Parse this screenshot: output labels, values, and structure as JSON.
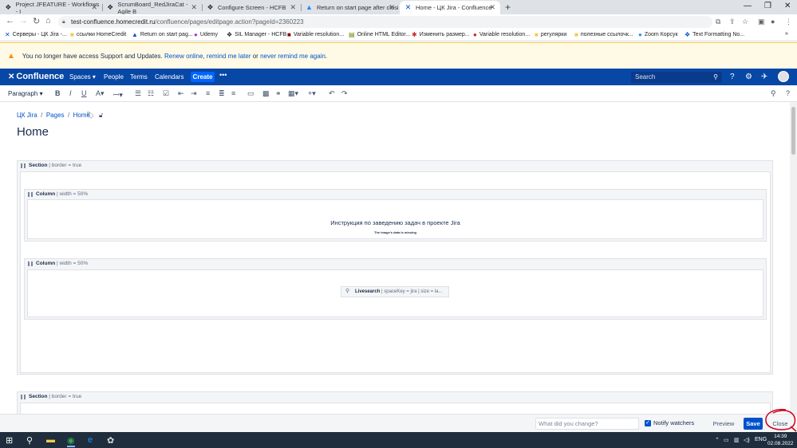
{
  "browser": {
    "tabs": [
      {
        "title": "Project JFEATURE - Workflows - I",
        "icon": "jira-icon"
      },
      {
        "title": "ScrumBoard_RedJiraCat - Agile B",
        "icon": "jira-icon"
      },
      {
        "title": "Configure Screen - HCFB",
        "icon": "jira-icon"
      },
      {
        "title": "Return on start page after closi",
        "icon": "atlassian-icon"
      },
      {
        "title": "Home - ЦК Jira - Confluence",
        "icon": "confluence-icon"
      }
    ],
    "url_host": "test-confluence.homecredit.ru",
    "url_path": "/confluence/pages/editpage.action?pageId=2360223",
    "bookmarks": [
      "Серверы - ЦК Jira -...",
      "ссылки HomeCredit",
      "Return on start pag...",
      "Udemy",
      "SIL Manager - HCFB",
      "Variable resolution...",
      "Online HTML Editor...",
      "Изменить размер...",
      "Variable resolution...",
      "регулярки",
      "полезные ссылочк...",
      "Zoom Корсук",
      "Text Formatting No..."
    ]
  },
  "banner": {
    "text": "You no longer have access Support and Updates.",
    "renew": "Renew online",
    "sep1": ",",
    "remind_later": "remind me later",
    "or": "or",
    "never": "never remind me again",
    "end": "."
  },
  "header": {
    "logo": "Confluence",
    "nav": [
      "Spaces",
      "People",
      "Terms",
      "Calendars"
    ],
    "create": "Create",
    "search_placeholder": "Search"
  },
  "toolbar": {
    "paragraph": "Paragraph"
  },
  "page": {
    "breadcrumb": [
      "ЦК Jira",
      "Pages",
      "Home"
    ],
    "title": "Home",
    "section_label": "Section",
    "section_param": "| border = true",
    "column_label": "Column",
    "column_param": "| width = 50%",
    "instruction_text": "Инструкция по заведению задач в проекте Jira",
    "image_missing": "The image's data is missing",
    "livesearch_label": "Livesearch",
    "livesearch_param": "| spaceKey = jira | size = la..."
  },
  "bottom_bar": {
    "change_placeholder": "What did you change?",
    "notify_watchers": "Notify watchers",
    "preview": "Preview",
    "save": "Save",
    "close": "Close"
  },
  "taskbar": {
    "lang": "ENG",
    "time": "14:39",
    "date": "02.08.2022"
  },
  "colors": {
    "confluence_blue": "#0747a6",
    "save_blue": "#0052cc",
    "banner_bg": "#fffae6",
    "annotation_red": "#d0021b"
  }
}
